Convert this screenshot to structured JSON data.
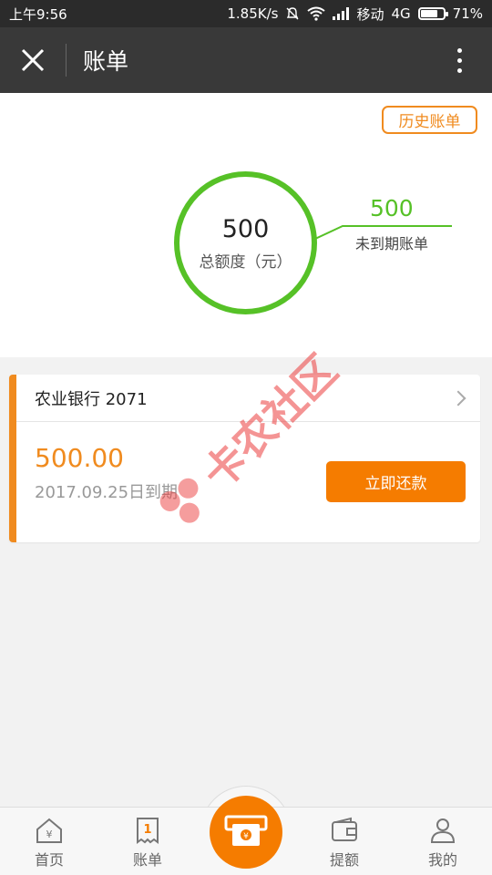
{
  "status": {
    "time": "上午9:56",
    "speed": "1.85K/s",
    "carrier": "移动",
    "network": "4G",
    "battery": "71%",
    "battery_level": 0.71
  },
  "header": {
    "title": "账单",
    "icons": [
      "close-icon",
      "more-vert-icon"
    ]
  },
  "summary": {
    "history_label": "历史账单",
    "total_value": "500",
    "total_label": "总额度（元）",
    "due_value": "500",
    "due_label": "未到期账单"
  },
  "bill": {
    "bank": "农业银行 2071",
    "amount": "500.00",
    "due_date": "2017.09.25日到期",
    "action": "立即还款"
  },
  "watermark": "卡农社区",
  "nav": {
    "items": [
      {
        "label": "首页",
        "icon": "home-icon"
      },
      {
        "label": "账单",
        "icon": "bill-icon"
      },
      {
        "label": "",
        "icon": "cash-icon"
      },
      {
        "label": "提额",
        "icon": "wallet-icon"
      },
      {
        "label": "我的",
        "icon": "user-icon"
      }
    ]
  },
  "colors": {
    "accent": "#f57c00",
    "green": "#56c127",
    "header": "#393939"
  }
}
